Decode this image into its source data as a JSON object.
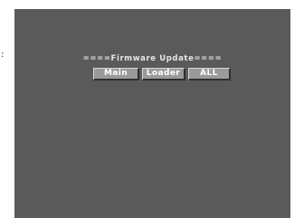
{
  "edge_mark": ":",
  "firmware_update": {
    "title": "====Firmware Update====",
    "buttons": {
      "main": "Main",
      "loader": "Loader",
      "all": "ALL"
    }
  },
  "colors": {
    "screen_background": "#5a5a5a",
    "button_face": "#9a9a9a",
    "text": "#ffffff"
  }
}
